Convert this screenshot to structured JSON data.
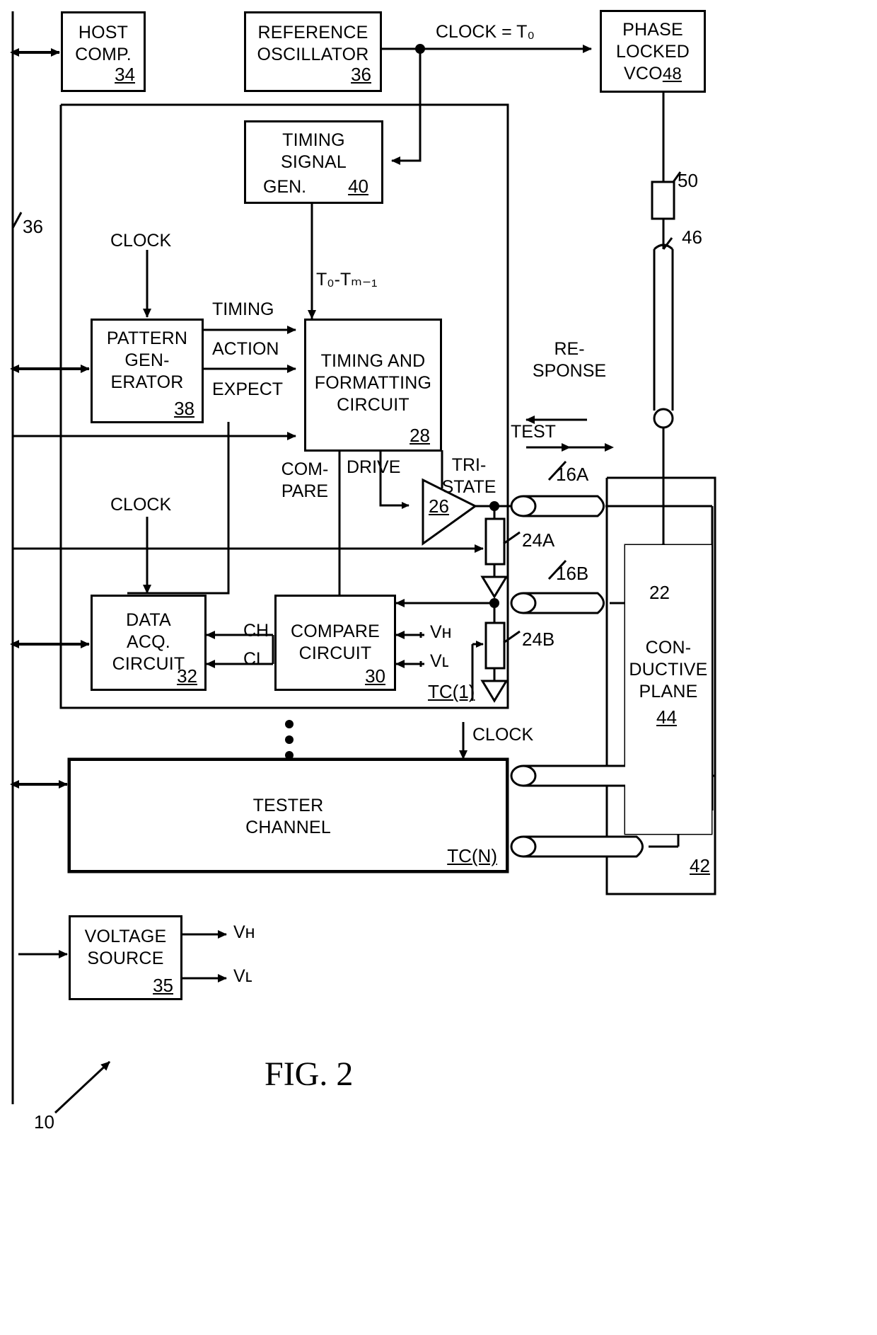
{
  "figure": {
    "caption": "FIG. 2",
    "system_ref": "10"
  },
  "blocks": {
    "host_comp": {
      "lines": [
        "HOST",
        "COMP."
      ],
      "ref": "34"
    },
    "ref_osc": {
      "lines": [
        "REFERENCE",
        "OSCILLATOR"
      ],
      "ref": "36"
    },
    "phase_locked": {
      "lines": [
        "PHASE",
        "LOCKED",
        "VCO"
      ],
      "ref": "48"
    },
    "timing_sig_gen": {
      "lines": [
        "TIMING",
        "SIGNAL",
        "GEN."
      ],
      "ref": "40"
    },
    "pattern_gen": {
      "lines": [
        "PATTERN",
        "GEN-",
        "ERATOR"
      ],
      "ref": "38"
    },
    "timing_fmt": {
      "lines": [
        "TIMING AND",
        "FORMATTING",
        "CIRCUIT"
      ],
      "ref": "28"
    },
    "data_acq": {
      "lines": [
        "DATA",
        "ACQ.",
        "CIRCUIT"
      ],
      "ref": "32"
    },
    "compare": {
      "lines": [
        "COMPARE",
        "CIRCUIT"
      ],
      "ref": "30"
    },
    "tester_channel": {
      "lines": [
        "TESTER",
        "CHANNEL"
      ],
      "ref": "TC(N)"
    },
    "cond_plane": {
      "lines": [
        "CON-",
        "DUCTIVE",
        "PLANE"
      ],
      "ref": "44"
    },
    "voltage_source": {
      "lines": [
        "VOLTAGE",
        "SOURCE"
      ],
      "ref": "35"
    },
    "driver": {
      "ref": "26"
    }
  },
  "signals": {
    "clock_t0": "CLOCK = T₀",
    "clock_pattern": "CLOCK",
    "clock_data": "CLOCK",
    "clock_tcn": "CLOCK",
    "timing": "TIMING",
    "action": "ACTION",
    "expect": "EXPECT",
    "t0_tm1": "T₀-Tₘ₋₁",
    "compare_line1": "COM-",
    "compare_line2": "PARE",
    "drive": "DRIVE",
    "tristate_line1": "TRI-",
    "tristate_line2": "STATE",
    "response_line1": "RE-",
    "response_line2": "SPONSE",
    "test": "TEST",
    "ch": "CH",
    "cl": "CL",
    "vh": "Vʜ",
    "vl": "Vʟ",
    "vh_out": "Vʜ",
    "vl_out": "Vʟ",
    "tc1": "TC(1)"
  },
  "callouts": {
    "left_bus": "36",
    "probe_tip": "50",
    "cable_46": "46",
    "pin_22": "22",
    "dut_42": "42",
    "line_16a": "16A",
    "line_16b": "16B",
    "res_24a": "24A",
    "res_24b": "24B"
  },
  "colors": {
    "ink": "#000000",
    "paper": "#ffffff"
  }
}
